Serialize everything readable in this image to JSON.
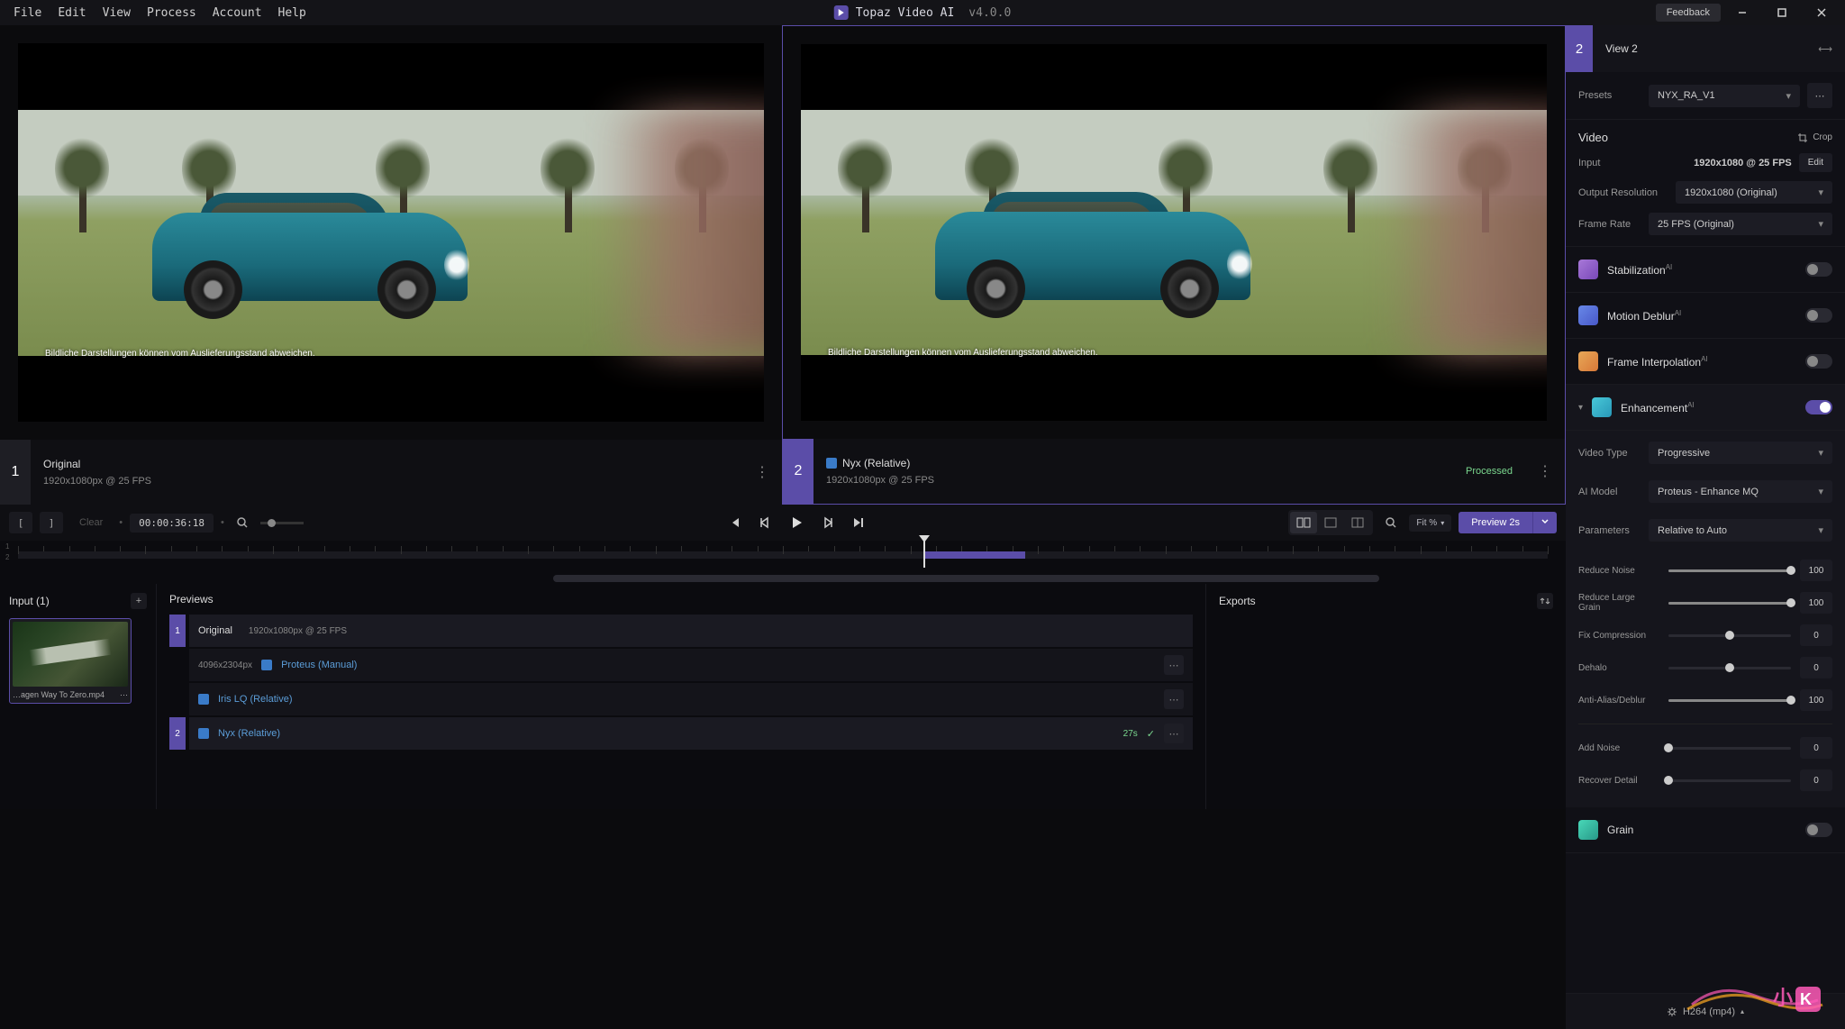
{
  "app": {
    "name": "Topaz Video AI",
    "version": "v4.0.0"
  },
  "menu": [
    "File",
    "Edit",
    "View",
    "Process",
    "Account",
    "Help"
  ],
  "feedback": "Feedback",
  "views": {
    "left": {
      "num": "1",
      "title": "Original",
      "sub": "1920x1080px @ 25 FPS",
      "disclaimer": "Bildliche Darstellungen können vom Auslieferungsstand abweichen."
    },
    "right": {
      "num": "2",
      "title": "Nyx (Relative)",
      "sub": "1920x1080px @ 25 FPS",
      "status": "Processed",
      "disclaimer": "Bildliche Darstellungen können vom Auslieferungsstand abweichen."
    }
  },
  "controls": {
    "clear": "Clear",
    "timecode": "00:00:36:18",
    "fit": "Fit %",
    "preview": "Preview 2s"
  },
  "sidebar": {
    "view_num": "2",
    "view_title": "View 2",
    "presets": {
      "label": "Presets",
      "value": "NYX_RA_V1"
    },
    "video": {
      "heading": "Video",
      "crop": "Crop",
      "input_label": "Input",
      "input_value": "1920x1080 @ 25 FPS",
      "edit": "Edit",
      "output_label": "Output Resolution",
      "output_value": "1920x1080 (Original)",
      "framerate_label": "Frame Rate",
      "framerate_value": "25 FPS (Original)"
    },
    "ai_sections": {
      "stabilization": "Stabilization",
      "motion_deblur": "Motion Deblur",
      "frame_interp": "Frame Interpolation",
      "enhancement": "Enhancement",
      "grain": "Grain",
      "ai_badge": "AI"
    },
    "enhancement_opts": {
      "video_type_label": "Video Type",
      "video_type_value": "Progressive",
      "ai_model_label": "AI Model",
      "ai_model_value": "Proteus - Enhance MQ",
      "parameters_label": "Parameters",
      "parameters_value": "Relative to Auto"
    },
    "sliders": {
      "reduce_noise": {
        "label": "Reduce Noise",
        "value": "100",
        "pct": 100
      },
      "reduce_large_grain": {
        "label": "Reduce Large Grain",
        "value": "100",
        "pct": 100
      },
      "fix_compression": {
        "label": "Fix Compression",
        "value": "0",
        "pct": 50
      },
      "dehalo": {
        "label": "Dehalo",
        "value": "0",
        "pct": 50
      },
      "anti_alias": {
        "label": "Anti-Alias/Deblur",
        "value": "100",
        "pct": 100
      },
      "add_noise": {
        "label": "Add Noise",
        "value": "0",
        "pct": 0
      },
      "recover_detail": {
        "label": "Recover Detail",
        "value": "0",
        "pct": 0
      }
    }
  },
  "bottom": {
    "input_title": "Input (1)",
    "input_file": "…agen Way To Zero.mp4",
    "previews_title": "Previews",
    "preview_rows": {
      "original": {
        "label": "Original",
        "res": "1920x1080px @ 25 FPS"
      },
      "proteus": {
        "res": "4096x2304px",
        "label": "Proteus (Manual)"
      },
      "iris": {
        "label": "Iris LQ (Relative)"
      },
      "nyx": {
        "label": "Nyx (Relative)",
        "time": "27s"
      }
    },
    "exports_title": "Exports"
  },
  "export_footer": "H264 (mp4)"
}
